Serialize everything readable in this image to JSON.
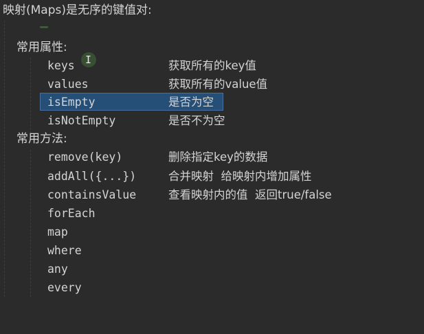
{
  "title": "映射(Maps)是无序的键值对:",
  "sections": {
    "properties": {
      "heading": "常用属性:",
      "items": [
        {
          "name": "keys",
          "desc": "获取所有的key值"
        },
        {
          "name": "values",
          "desc": "获取所有的value值"
        },
        {
          "name": "isEmpty",
          "desc": "是否为空"
        },
        {
          "name": "isNotEmpty",
          "desc": "是否不为空"
        }
      ]
    },
    "methods": {
      "heading": "常用方法:",
      "items": [
        {
          "name": "remove(key)",
          "desc": "删除指定key的数据"
        },
        {
          "name": "addAll({...})",
          "desc": "合并映射  给映射内增加属性"
        },
        {
          "name": "containsValue",
          "desc": "查看映射内的值  返回true/false"
        },
        {
          "name": "forEach",
          "desc": ""
        },
        {
          "name": "map",
          "desc": ""
        },
        {
          "name": "where",
          "desc": ""
        },
        {
          "name": "any",
          "desc": ""
        },
        {
          "name": "every",
          "desc": ""
        }
      ]
    }
  },
  "selection": {
    "selected_text": "isEmpty        是否为空"
  },
  "colors": {
    "background": "#2b2b2b",
    "text": "#d4d4d4",
    "selection": "#264f78"
  },
  "icons": {
    "text_cursor": "i-beam-cursor-icon"
  }
}
